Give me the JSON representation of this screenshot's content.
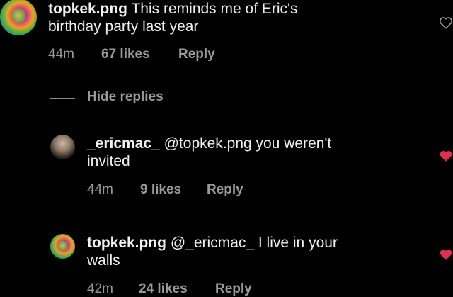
{
  "comments": [
    {
      "username": "topkek.png",
      "text": "This reminds me of Eric's",
      "text2": "birthday party last year",
      "time": "44m",
      "likes": "67 likes",
      "reply": "Reply",
      "liked": false
    },
    {
      "username": "_ericmac_",
      "text": "@topkek.png you weren't",
      "text2": "invited",
      "time": "44m",
      "likes": "9 likes",
      "reply": "Reply",
      "liked": true
    },
    {
      "username": "topkek.png",
      "text": "@_ericmac_ I live in your",
      "text2": "walls",
      "time": "42m",
      "likes": "24 likes",
      "reply": "Reply",
      "liked": true
    }
  ],
  "hide_replies": "Hide replies",
  "colors": {
    "liked_heart": "#e0304a",
    "muted_text": "#9a9a9a",
    "background": "#000000"
  },
  "icons": {
    "heart_outline": "heart-outline-icon",
    "heart_filled": "heart-filled-icon"
  }
}
